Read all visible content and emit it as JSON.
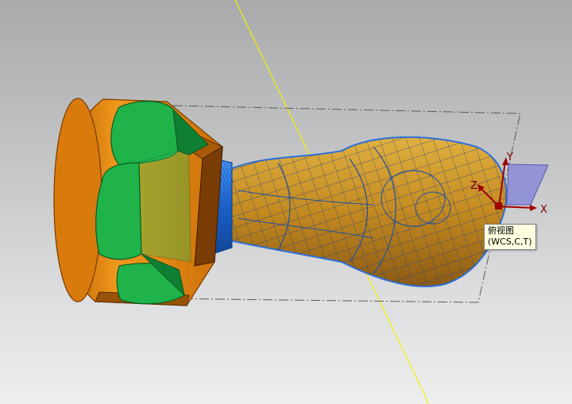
{
  "viewport": {
    "background_top": "#a9aaab",
    "background_bottom": "#eeeeee"
  },
  "tooltip": {
    "line1": "俯视图",
    "line2": "(WCS,C,T)"
  },
  "triad": {
    "x_label": "X",
    "y_label": "Y",
    "z_label": "Z"
  },
  "colors": {
    "nut_body": "#e88a12",
    "nut_face": "#1fb34a",
    "thread": "#1f6fd6",
    "collar": "#c81ec8",
    "grip_mesh": "#c8922a",
    "mesh_lines": "#1e4fa0",
    "selection": "#2d6fd9",
    "yellow_axis": "#f2f200",
    "bounding_box": "#5a5a5a",
    "plane": "#8a8ad8"
  },
  "icons": [
    "wcs-triad-icon",
    "datum-plane-icon"
  ]
}
